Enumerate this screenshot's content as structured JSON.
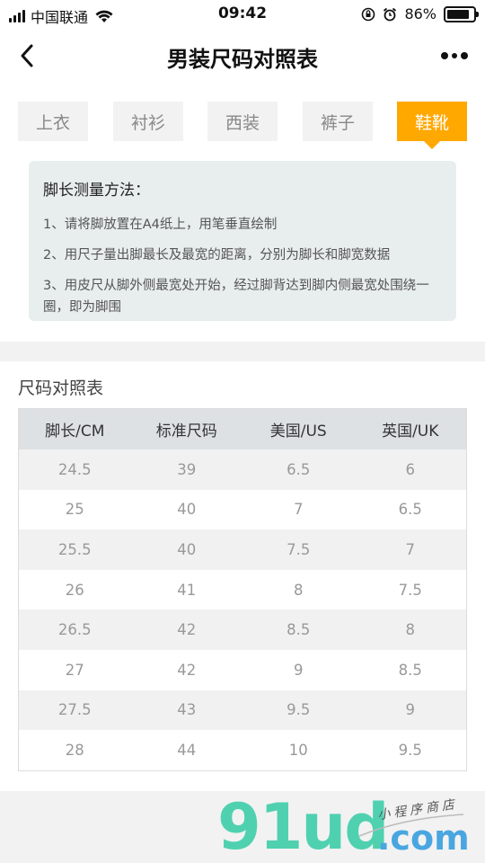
{
  "status_bar": {
    "carrier": "中国联通",
    "time": "09:42",
    "battery": "86%",
    "battery_level": 0.86
  },
  "nav": {
    "title": "男装尺码对照表"
  },
  "tabs": [
    {
      "label": "上衣",
      "active": false
    },
    {
      "label": "衬衫",
      "active": false
    },
    {
      "label": "西装",
      "active": false
    },
    {
      "label": "裤子",
      "active": false
    },
    {
      "label": "鞋靴",
      "active": true
    }
  ],
  "method": {
    "title": "脚长测量方法：",
    "items": [
      "1、请将脚放置在A4纸上，用笔垂直绘制",
      "2、用尺子量出脚最长及最宽的距离，分别为脚长和脚宽数据",
      "3、用皮尺从脚外侧最宽处开始，经过脚背达到脚内侧最宽处围绕一圈，即为脚围"
    ]
  },
  "size_table": {
    "title": "尺码对照表",
    "headers": [
      "脚长/CM",
      "标准尺码",
      "美国/US",
      "英国/UK"
    ],
    "rows": [
      [
        "24.5",
        "39",
        "6.5",
        "6"
      ],
      [
        "25",
        "40",
        "7",
        "6.5"
      ],
      [
        "25.5",
        "40",
        "7.5",
        "7"
      ],
      [
        "26",
        "41",
        "8",
        "7.5"
      ],
      [
        "26.5",
        "42",
        "8.5",
        "8"
      ],
      [
        "27",
        "42",
        "9",
        "8.5"
      ],
      [
        "27.5",
        "43",
        "9.5",
        "9"
      ],
      [
        "28",
        "44",
        "10",
        "9.5"
      ]
    ]
  },
  "watermark": {
    "logo": "91ud",
    "domain": ".com",
    "tagline": "小程序商店"
  },
  "colors": {
    "accent": "#ffa800",
    "header_bg": "#dde1e4",
    "method_bg": "#e8eded"
  }
}
